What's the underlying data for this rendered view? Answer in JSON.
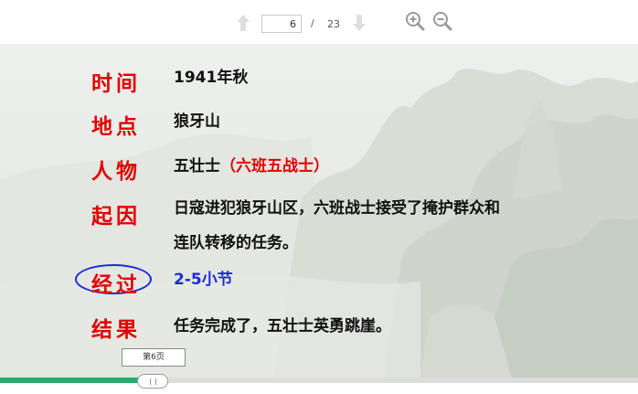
{
  "toolbar": {
    "prev_icon": "arrow-up-icon",
    "next_icon": "arrow-down-icon",
    "current_page": "6",
    "separator": "/",
    "total_pages": "23",
    "zoom_in_icon": "zoom-in-icon",
    "zoom_out_icon": "zoom-out-icon"
  },
  "slide": {
    "rows": {
      "time": {
        "label": "时间",
        "value": "1941年秋"
      },
      "place": {
        "label": "地点",
        "value": "狼牙山"
      },
      "people": {
        "label": "人物",
        "value": "五壮士",
        "value_note": "（六班五战士）"
      },
      "cause": {
        "label": "起因",
        "value_line1": "日寇进犯狼牙山区，六班战士接受了掩护群众和",
        "value_line2": "连队转移的任务。"
      },
      "process": {
        "label": "经过",
        "value": "2-5小节"
      },
      "result": {
        "label": "结果",
        "value": "任务完成了，五壮士英勇跳崖。"
      }
    }
  },
  "progress": {
    "tooltip": "第6页",
    "fraction": 0.22
  },
  "colors": {
    "label_red": "#e00000",
    "highlight_blue": "#1a2cd4",
    "progress_green": "#33a66e"
  }
}
